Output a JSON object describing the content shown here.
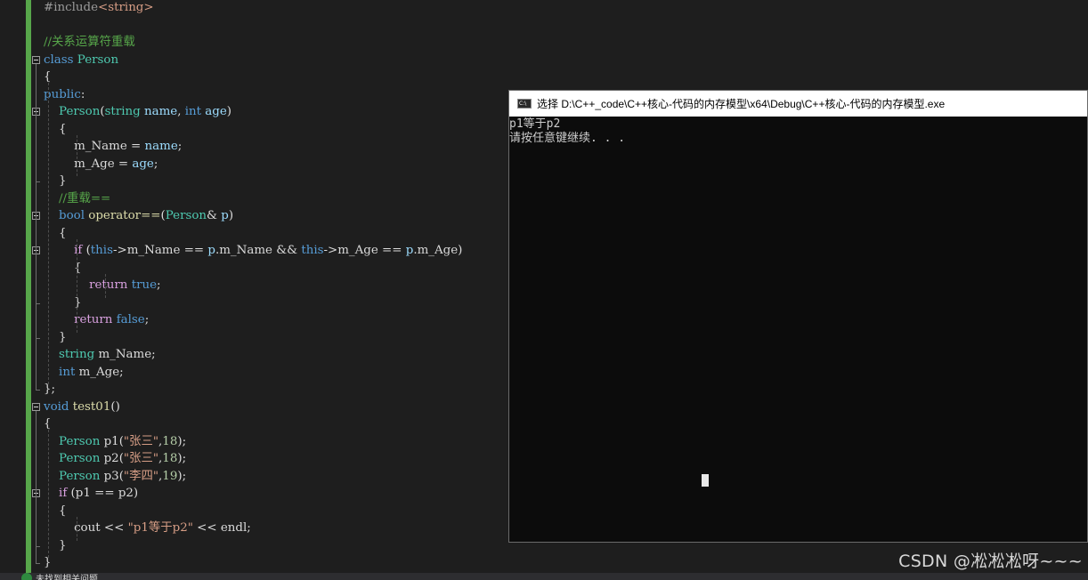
{
  "editor": {
    "lines": [
      [
        {
          "t": "#include",
          "c": "t-pp"
        },
        {
          "t": "<string>",
          "c": "t-str"
        }
      ],
      [],
      [
        {
          "t": "//关系运算符重载",
          "c": "t-cmt"
        }
      ],
      [
        {
          "t": "class",
          "c": "t-kw"
        },
        {
          "t": " ",
          "c": "t-plain"
        },
        {
          "t": "Person",
          "c": "t-type"
        }
      ],
      [
        {
          "t": "{",
          "c": "t-plain"
        }
      ],
      [
        {
          "t": "public",
          "c": "t-kw"
        },
        {
          "t": ":",
          "c": "t-plain"
        }
      ],
      [
        {
          "t": "    ",
          "c": "t-plain"
        },
        {
          "t": "Person",
          "c": "t-type"
        },
        {
          "t": "(",
          "c": "t-plain"
        },
        {
          "t": "string",
          "c": "t-type"
        },
        {
          "t": " ",
          "c": "t-plain"
        },
        {
          "t": "name",
          "c": "t-param"
        },
        {
          "t": ", ",
          "c": "t-plain"
        },
        {
          "t": "int",
          "c": "t-kw"
        },
        {
          "t": " ",
          "c": "t-plain"
        },
        {
          "t": "age",
          "c": "t-param"
        },
        {
          "t": ")",
          "c": "t-plain"
        }
      ],
      [
        {
          "t": "    {",
          "c": "t-plain"
        }
      ],
      [
        {
          "t": "        ",
          "c": "t-plain"
        },
        {
          "t": "m_Name",
          "c": "t-fld"
        },
        {
          "t": " = ",
          "c": "t-plain"
        },
        {
          "t": "name",
          "c": "t-param"
        },
        {
          "t": ";",
          "c": "t-plain"
        }
      ],
      [
        {
          "t": "        ",
          "c": "t-plain"
        },
        {
          "t": "m_Age",
          "c": "t-fld"
        },
        {
          "t": " = ",
          "c": "t-plain"
        },
        {
          "t": "age",
          "c": "t-param"
        },
        {
          "t": ";",
          "c": "t-plain"
        }
      ],
      [
        {
          "t": "    }",
          "c": "t-plain"
        }
      ],
      [
        {
          "t": "    //重载==",
          "c": "t-cmt"
        }
      ],
      [
        {
          "t": "    ",
          "c": "t-plain"
        },
        {
          "t": "bool",
          "c": "t-kw"
        },
        {
          "t": " ",
          "c": "t-plain"
        },
        {
          "t": "operator==",
          "c": "t-fn"
        },
        {
          "t": "(",
          "c": "t-plain"
        },
        {
          "t": "Person",
          "c": "t-type"
        },
        {
          "t": "& ",
          "c": "t-plain"
        },
        {
          "t": "p",
          "c": "t-param"
        },
        {
          "t": ")",
          "c": "t-plain"
        }
      ],
      [
        {
          "t": "    {",
          "c": "t-plain"
        }
      ],
      [
        {
          "t": "        ",
          "c": "t-plain"
        },
        {
          "t": "if",
          "c": "t-ctl"
        },
        {
          "t": " (",
          "c": "t-plain"
        },
        {
          "t": "this",
          "c": "t-kw"
        },
        {
          "t": "->",
          "c": "t-plain"
        },
        {
          "t": "m_Name",
          "c": "t-fld"
        },
        {
          "t": " == ",
          "c": "t-plain"
        },
        {
          "t": "p",
          "c": "t-param"
        },
        {
          "t": ".",
          "c": "t-plain"
        },
        {
          "t": "m_Name",
          "c": "t-fld"
        },
        {
          "t": " && ",
          "c": "t-plain"
        },
        {
          "t": "this",
          "c": "t-kw"
        },
        {
          "t": "->",
          "c": "t-plain"
        },
        {
          "t": "m_Age",
          "c": "t-fld"
        },
        {
          "t": " == ",
          "c": "t-plain"
        },
        {
          "t": "p",
          "c": "t-param"
        },
        {
          "t": ".",
          "c": "t-plain"
        },
        {
          "t": "m_Age",
          "c": "t-fld"
        },
        {
          "t": ")",
          "c": "t-plain"
        }
      ],
      [
        {
          "t": "        {",
          "c": "t-plain"
        }
      ],
      [
        {
          "t": "            ",
          "c": "t-plain"
        },
        {
          "t": "return",
          "c": "t-ctl"
        },
        {
          "t": " ",
          "c": "t-plain"
        },
        {
          "t": "true",
          "c": "t-kw"
        },
        {
          "t": ";",
          "c": "t-plain"
        }
      ],
      [
        {
          "t": "        }",
          "c": "t-plain"
        }
      ],
      [
        {
          "t": "        ",
          "c": "t-plain"
        },
        {
          "t": "return",
          "c": "t-ctl"
        },
        {
          "t": " ",
          "c": "t-plain"
        },
        {
          "t": "false",
          "c": "t-kw"
        },
        {
          "t": ";",
          "c": "t-plain"
        }
      ],
      [
        {
          "t": "    }",
          "c": "t-plain"
        }
      ],
      [
        {
          "t": "    ",
          "c": "t-plain"
        },
        {
          "t": "string",
          "c": "t-type"
        },
        {
          "t": " ",
          "c": "t-plain"
        },
        {
          "t": "m_Name",
          "c": "t-fld"
        },
        {
          "t": ";",
          "c": "t-plain"
        }
      ],
      [
        {
          "t": "    ",
          "c": "t-plain"
        },
        {
          "t": "int",
          "c": "t-kw"
        },
        {
          "t": " ",
          "c": "t-plain"
        },
        {
          "t": "m_Age",
          "c": "t-fld"
        },
        {
          "t": ";",
          "c": "t-plain"
        }
      ],
      [
        {
          "t": "};",
          "c": "t-plain"
        }
      ],
      [
        {
          "t": "void",
          "c": "t-kw"
        },
        {
          "t": " ",
          "c": "t-plain"
        },
        {
          "t": "test01",
          "c": "t-fn"
        },
        {
          "t": "()",
          "c": "t-plain"
        }
      ],
      [
        {
          "t": "{",
          "c": "t-plain"
        }
      ],
      [
        {
          "t": "    ",
          "c": "t-plain"
        },
        {
          "t": "Person",
          "c": "t-type"
        },
        {
          "t": " ",
          "c": "t-plain"
        },
        {
          "t": "p1",
          "c": "t-plain"
        },
        {
          "t": "(",
          "c": "t-plain"
        },
        {
          "t": "\"张三\"",
          "c": "t-str"
        },
        {
          "t": ",",
          "c": "t-plain"
        },
        {
          "t": "18",
          "c": "t-num"
        },
        {
          "t": ");",
          "c": "t-plain"
        }
      ],
      [
        {
          "t": "    ",
          "c": "t-plain"
        },
        {
          "t": "Person",
          "c": "t-type"
        },
        {
          "t": " ",
          "c": "t-plain"
        },
        {
          "t": "p2",
          "c": "t-plain"
        },
        {
          "t": "(",
          "c": "t-plain"
        },
        {
          "t": "\"张三\"",
          "c": "t-str"
        },
        {
          "t": ",",
          "c": "t-plain"
        },
        {
          "t": "18",
          "c": "t-num"
        },
        {
          "t": ");",
          "c": "t-plain"
        }
      ],
      [
        {
          "t": "    ",
          "c": "t-plain"
        },
        {
          "t": "Person",
          "c": "t-type"
        },
        {
          "t": " ",
          "c": "t-plain"
        },
        {
          "t": "p3",
          "c": "t-plain"
        },
        {
          "t": "(",
          "c": "t-plain"
        },
        {
          "t": "\"李四\"",
          "c": "t-str"
        },
        {
          "t": ",",
          "c": "t-plain"
        },
        {
          "t": "19",
          "c": "t-num"
        },
        {
          "t": ");",
          "c": "t-plain"
        }
      ],
      [
        {
          "t": "    ",
          "c": "t-plain"
        },
        {
          "t": "if",
          "c": "t-ctl"
        },
        {
          "t": " (",
          "c": "t-plain"
        },
        {
          "t": "p1",
          "c": "t-plain"
        },
        {
          "t": " == ",
          "c": "t-plain"
        },
        {
          "t": "p2",
          "c": "t-plain"
        },
        {
          "t": ")",
          "c": "t-plain"
        }
      ],
      [
        {
          "t": "    {",
          "c": "t-plain"
        }
      ],
      [
        {
          "t": "        ",
          "c": "t-plain"
        },
        {
          "t": "cout",
          "c": "t-plain"
        },
        {
          "t": " << ",
          "c": "t-plain"
        },
        {
          "t": "\"p1等于p2\"",
          "c": "t-str"
        },
        {
          "t": " << ",
          "c": "t-plain"
        },
        {
          "t": "endl",
          "c": "t-plain"
        },
        {
          "t": ";",
          "c": "t-plain"
        }
      ],
      [
        {
          "t": "    }",
          "c": "t-plain"
        }
      ],
      [
        {
          "t": "}",
          "c": "t-plain"
        }
      ]
    ]
  },
  "console": {
    "title": "选择 D:\\C++_code\\C++核心-代码的内存模型\\x64\\Debug\\C++核心-代码的内存模型.exe",
    "output": [
      "p1等于p2",
      "请按任意键继续. . ."
    ]
  },
  "status_bar": {
    "text": "未找到相关问题"
  },
  "watermark": "CSDN @凇凇凇呀~~~"
}
